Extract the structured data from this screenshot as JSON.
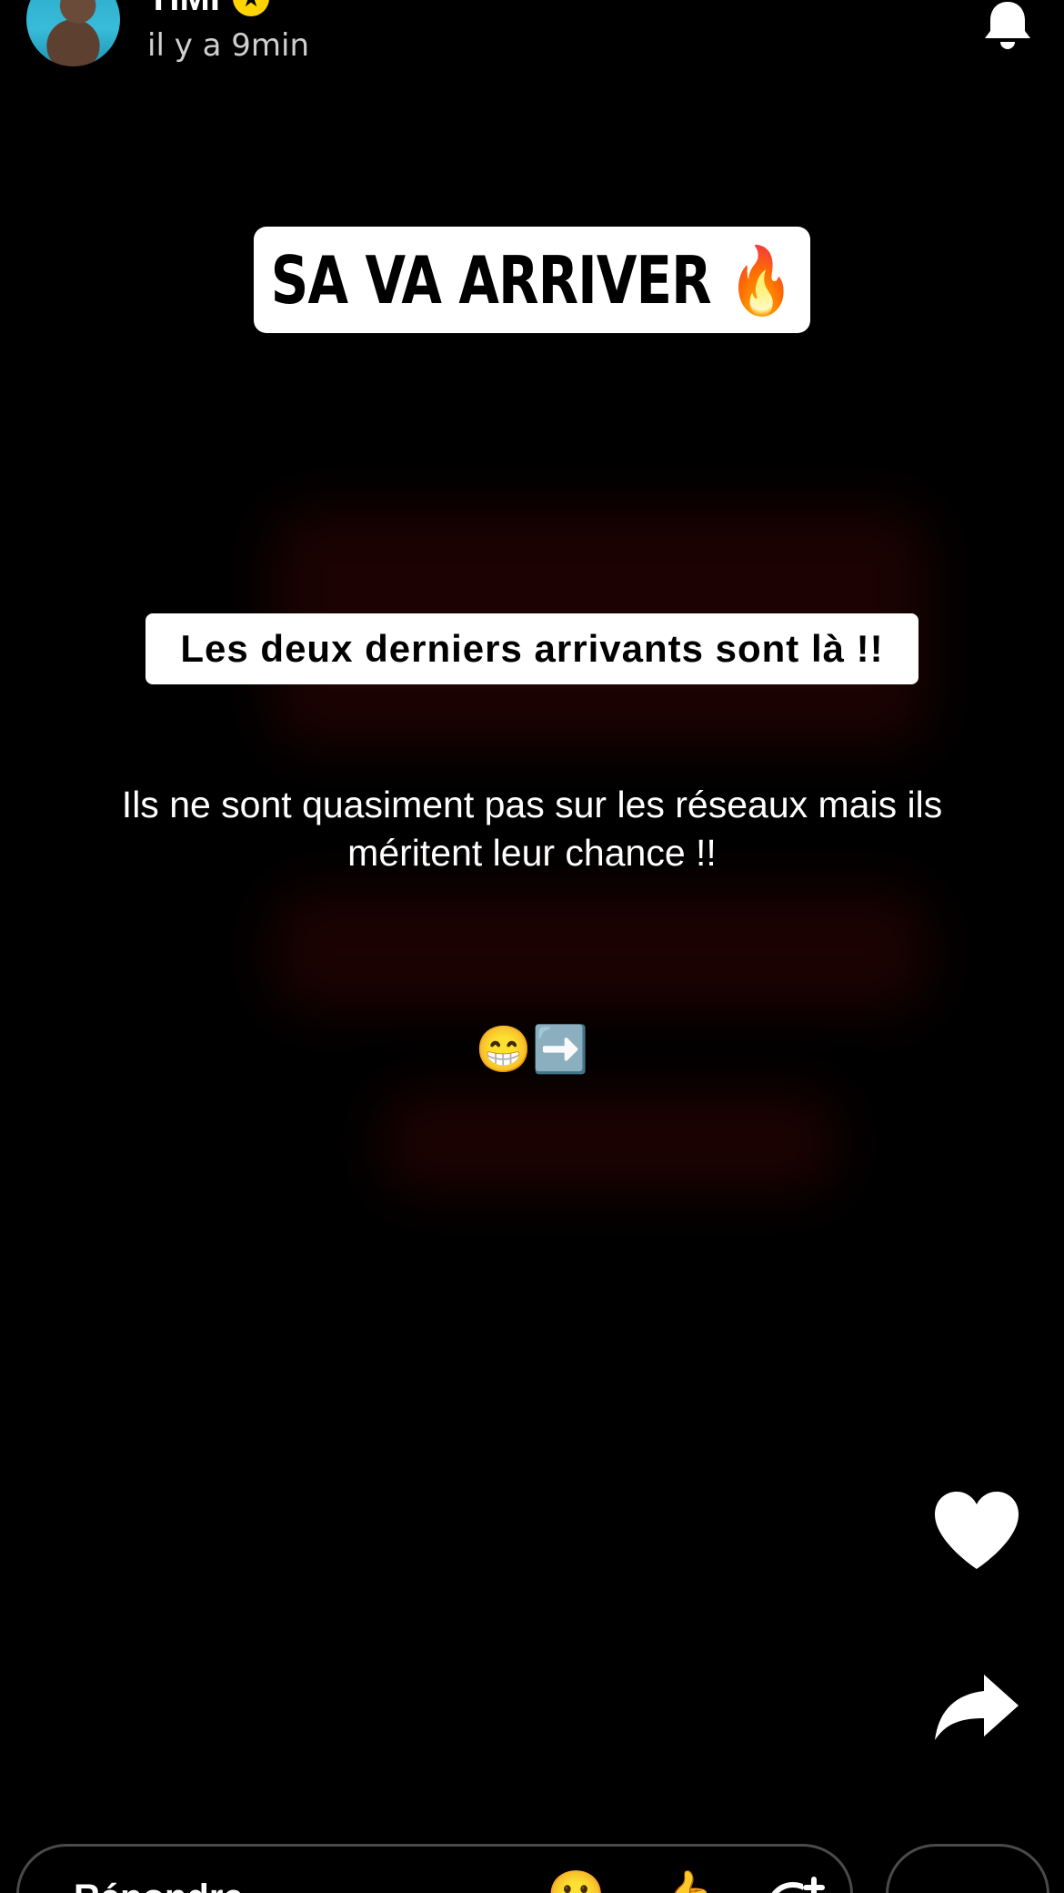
{
  "header": {
    "username": "TIMI",
    "verified_icon": "star-badge-icon",
    "star_glyph": "★",
    "post_time": "il y a 9min",
    "notification_icon": "bell-icon"
  },
  "story": {
    "title": "SA VA ARRIVER 🔥",
    "subtitle": "Les deux derniers arrivants sont là !!",
    "body": "Ils ne sont quasiment pas sur les réseaux mais ils méritent leur chance !!",
    "emojis": "😁➡️"
  },
  "actions": {
    "like_icon": "heart-icon",
    "share_icon": "share-arrow-icon"
  },
  "reply_bar": {
    "placeholder": "Répondre...",
    "emoji_icon": "🙂",
    "thumb_icon": "👍",
    "sticker_icon": "add-sticker-icon"
  },
  "colors": {
    "background": "#000000",
    "badge": "#ffd400",
    "card": "#ffffff",
    "accent_green": "#3fcf4e"
  }
}
